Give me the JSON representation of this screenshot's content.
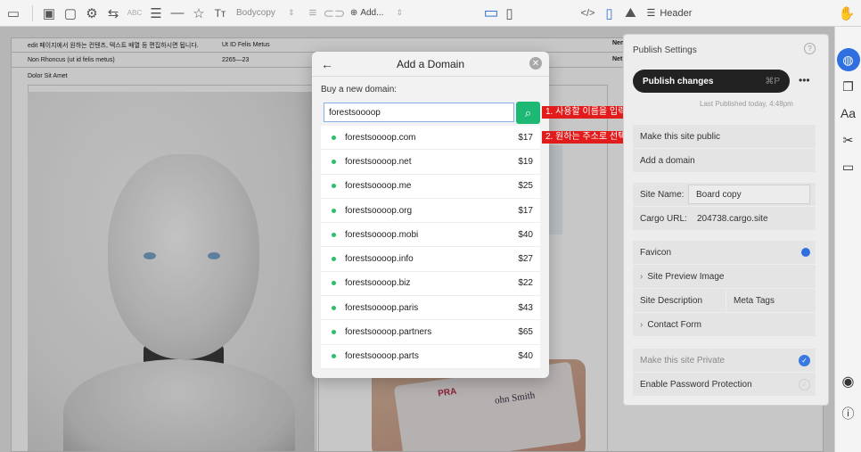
{
  "toolbar": {
    "style_select": "Bodycopy",
    "add_label": "Add...",
    "header_label": "Header"
  },
  "page": {
    "row1_col1": "edit 페이지에서 원하는 컨텐츠, 텍스트 배열 등 편집하시면 됩니다.",
    "row1_col2": "Ut ID Felis Metus",
    "row2_col1": "Non Rhoncus (ut id felis metus)",
    "row2_col2": "2265—23",
    "row3_col1": "Dolor Sit Amet",
    "right_snip1": "Nen",
    "right_snip2": "Net",
    "card_text1": "ohn Smith",
    "card_text2": "PRA"
  },
  "modal": {
    "title": "Add a Domain",
    "buy_label": "Buy a new domain:",
    "search_value": "forestsoooop",
    "domains": [
      {
        "name": "forestsoooop.com",
        "price": "$17"
      },
      {
        "name": "forestsoooop.net",
        "price": "$19"
      },
      {
        "name": "forestsoooop.me",
        "price": "$25"
      },
      {
        "name": "forestsoooop.org",
        "price": "$17"
      },
      {
        "name": "forestsoooop.mobi",
        "price": "$40"
      },
      {
        "name": "forestsoooop.info",
        "price": "$27"
      },
      {
        "name": "forestsoooop.biz",
        "price": "$22"
      },
      {
        "name": "forestsoooop.paris",
        "price": "$43"
      },
      {
        "name": "forestsoooop.partners",
        "price": "$65"
      },
      {
        "name": "forestsoooop.parts",
        "price": "$40"
      }
    ]
  },
  "annotations": {
    "step1": "1. 사용할 이름을 입력 후 검색",
    "step2": "2. 원하는 주소로 선택"
  },
  "panel": {
    "title": "Publish Settings",
    "publish_label": "Publish changes",
    "publish_shortcut": "⌘P",
    "last_published": "Last Published today, 4:48pm",
    "make_public": "Make this site public",
    "add_domain": "Add a domain",
    "site_name_label": "Site Name:",
    "site_name_value": "Board copy",
    "cargo_url_label": "Cargo URL:",
    "cargo_url_value": "204738.cargo.site",
    "favicon": "Favicon",
    "site_preview_image": "Site Preview Image",
    "site_description": "Site Description",
    "meta_tags": "Meta Tags",
    "contact_form": "Contact Form",
    "make_private": "Make this site Private",
    "password_protection": "Enable Password Protection"
  },
  "rail": {
    "text_icon_label": "Aa"
  },
  "colors": {
    "accent": "#2f6fe0",
    "search_green": "#1cb874",
    "annotation_red": "#e21b1b"
  }
}
